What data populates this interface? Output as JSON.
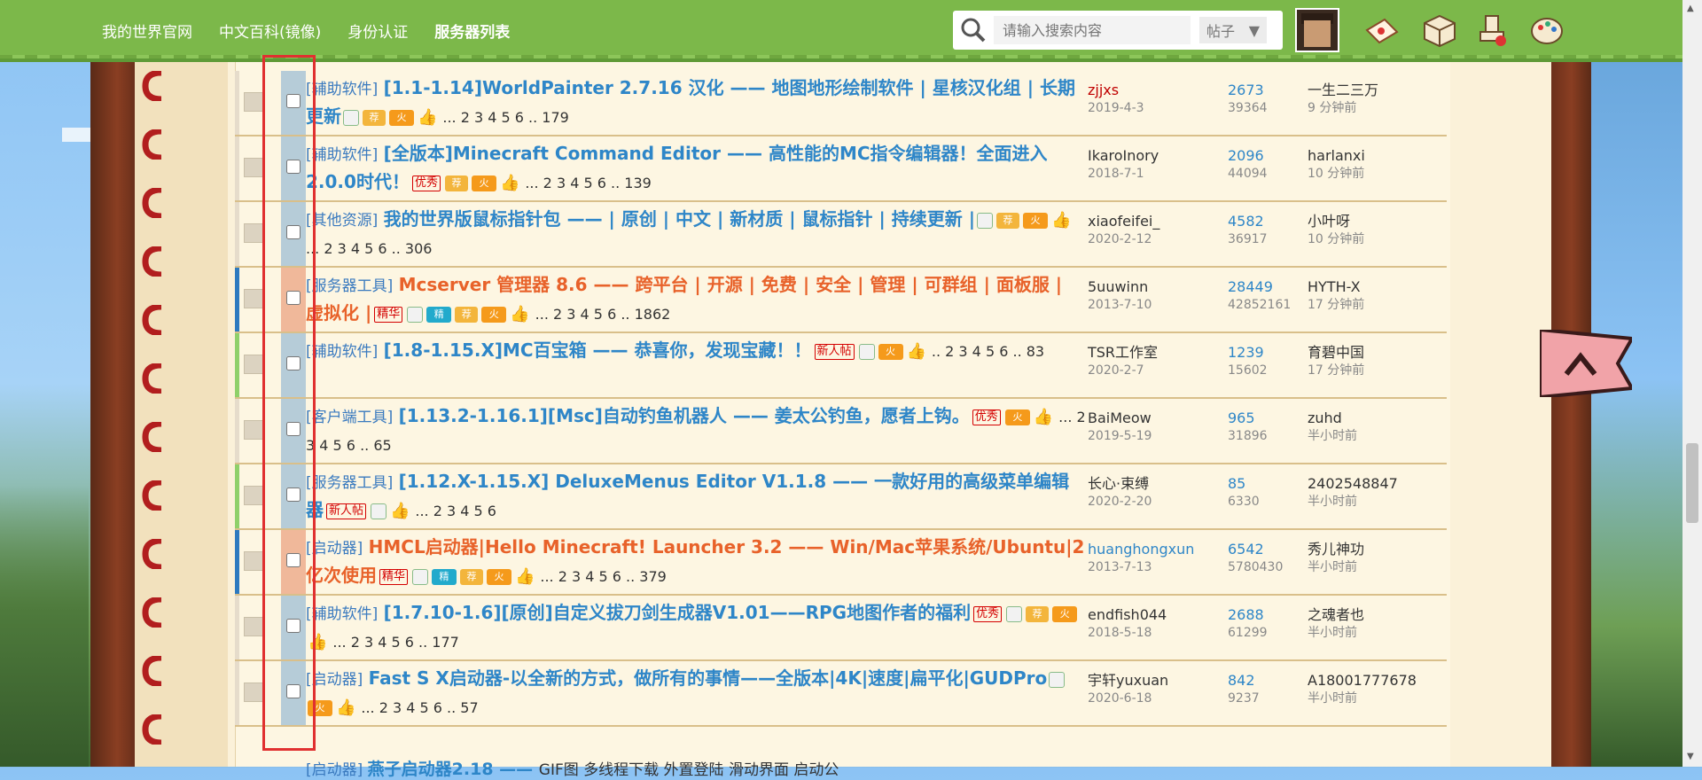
{
  "nav": {
    "items": [
      {
        "label": "我的世界官网"
      },
      {
        "label": "中文百科(镜像)"
      },
      {
        "label": "身份认证"
      },
      {
        "label": "服务器列表"
      }
    ]
  },
  "search": {
    "placeholder": "请输入搜索内容",
    "type": "帖子"
  },
  "threads": [
    {
      "category": "[辅助软件]",
      "title": "[1.1-1.14]WorldPainter 2.7.16 汉化 —— 地图地形绘制软件 | 星核汉化组 | 长期更新",
      "pages": "... 2 3 4 5 6 .. 179",
      "author": "zjjxs",
      "date": "2019-4-3",
      "replies": "2673",
      "views": "39364",
      "last_user": "一生二三万",
      "last_time": "9 分钟前"
    },
    {
      "category": "[辅助软件]",
      "title": "[全版本]Minecraft Command Editor —— 高性能的MC指令编辑器！全面进入2.0.0时代！",
      "badge": "优秀",
      "pages": "... 2 3 4 5 6 .. 139",
      "author": "IkaroInory",
      "date": "2018-7-1",
      "replies": "2096",
      "views": "44094",
      "last_user": "harlanxi",
      "last_time": "10 分钟前"
    },
    {
      "category": "[其他资源]",
      "title": "我的世界版鼠标指针包 —— | 原创 | 中文 | 新材质 | 鼠标指针 | 持续更新 |",
      "pages": "... 2 3 4 5 6 .. 306",
      "author": "xiaofeifei_",
      "date": "2020-2-12",
      "replies": "4582",
      "views": "36917",
      "last_user": "小叶呀",
      "last_time": "10 分钟前"
    },
    {
      "category": "[服务器工具]",
      "title": "Mcserver 管理器 8.6 —— 跨平台 | 开源 | 免费 | 安全 | 管理 | 可群组 | 面板服 | 虚拟化 |",
      "badge": "精华",
      "pages": "... 2 3 4 5 6 .. 1862",
      "author": "5uuwinn",
      "date": "2013-7-10",
      "replies": "28449",
      "views": "42852161",
      "last_user": "HYTH-X",
      "last_time": "17 分钟前"
    },
    {
      "category": "[辅助软件]",
      "title": "[1.8-1.15.X]MC百宝箱 —— 恭喜你，发现宝藏！！",
      "badge": "新人帖",
      "pages": ".. 2 3 4 5 6 .. 83",
      "author": "TSR工作室",
      "date": "2020-2-7",
      "replies": "1239",
      "views": "15602",
      "last_user": "育碧中国",
      "last_time": "17 分钟前"
    },
    {
      "category": "[客户端工具]",
      "title": "[1.13.2-1.16.1][Msc]自动钓鱼机器人 —— 姜太公钓鱼，愿者上钩。",
      "badge": "优秀",
      "pages": "... 2 3 4 5 6 .. 65",
      "author": "BaiMeow",
      "date": "2019-5-19",
      "replies": "965",
      "views": "31896",
      "last_user": "zuhd",
      "last_time": "半小时前"
    },
    {
      "category": "[服务器工具]",
      "title": "[1.12.X-1.15.X] DeluxeMenus Editor V1.1.8 —— 一款好用的高级菜单编辑器",
      "badge": "新人帖",
      "pages": "... 2 3 4 5 6",
      "author": "长心·束缚",
      "date": "2020-2-20",
      "replies": "85",
      "views": "6330",
      "last_user": "2402548847",
      "last_time": "半小时前"
    },
    {
      "category": "[启动器]",
      "title": "HMCL启动器|Hello Minecraft! Launcher 3.2 —— Win/Mac苹果系统/Ubuntu|2亿次使用",
      "badge": "精华",
      "pages": "... 2 3 4 5 6 .. 379",
      "author": "huanghongxun",
      "date": "2013-7-13",
      "replies": "6542",
      "views": "5780430",
      "last_user": "秀儿神功",
      "last_time": "半小时前"
    },
    {
      "category": "[辅助软件]",
      "title": "[1.7.10-1.6][原创]自定义拔刀剑生成器V1.01——RPG地图作者的福利",
      "badge": "优秀",
      "pages": "... 2 3 4 5 6 .. 177",
      "author": "endfish044",
      "date": "2018-5-18",
      "replies": "2688",
      "views": "61299",
      "last_user": "之魂者也",
      "last_time": "半小时前"
    },
    {
      "category": "[启动器]",
      "title": "Fast S X启动器-以全新的方式，做所有的事情——全版本|4K|速度|扁平化|GUDPro",
      "pages": "... 2 3 4 5 6 .. 57",
      "author": "宇轩yuxuan",
      "date": "2020-6-18",
      "replies": "842",
      "views": "9237",
      "last_user": "A18001777678",
      "last_time": "半小时前"
    }
  ],
  "partial_row": {
    "category": "[启动器]",
    "title": "燕子启动器2.18 —— ",
    "tail": "GIF图 多线程下载 外置登陆 滑动界面 启动公"
  },
  "badges": {
    "jian": "荐",
    "huo": "火",
    "jing": "精"
  },
  "colors": {
    "nav_green": "#7cb84a",
    "title_blue": "#2e86c8",
    "title_orange": "#e8622a",
    "highlight": "#e03030"
  }
}
